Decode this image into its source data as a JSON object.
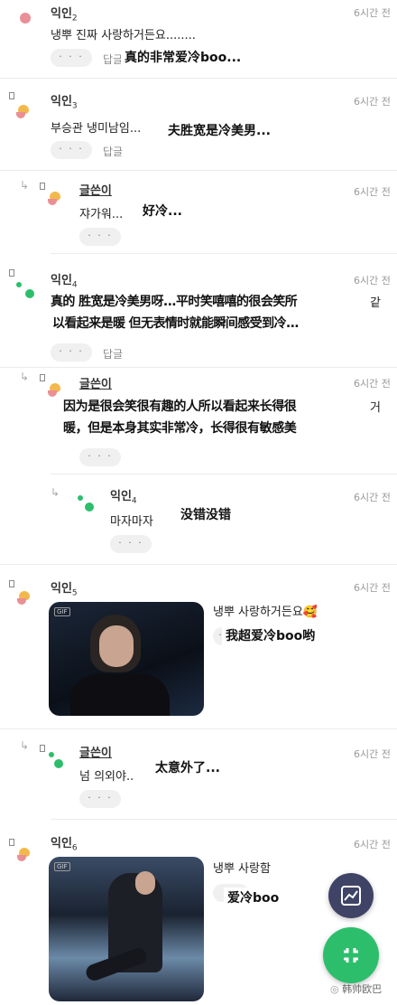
{
  "colors": {
    "accent_green": "#2dbe6c",
    "fab_navy": "#3f4366",
    "avatar_orange": "#f3b84c",
    "avatar_pink": "#e98f95"
  },
  "comments": [
    {
      "author": "익인",
      "num": "2",
      "time": "6시간 전",
      "text": "냉뿌 진짜 사랑하거든요........",
      "more": "· · ·",
      "reply": "답글",
      "caption": "真的非常爱冷boo..."
    },
    {
      "author": "익인",
      "num": "3",
      "time": "6시간 전",
      "text": "부승관 냉미남임...",
      "more": "· · ·",
      "reply": "답글",
      "caption": "夫胜宽是冷美男..."
    },
    {
      "author": "글쓴이",
      "time": "6시간 전",
      "text": "쟈가워...",
      "more": "· · ·",
      "caption": "好冷..."
    },
    {
      "author": "익인",
      "num": "4",
      "time": "6시간 전",
      "text": "",
      "more": "· · ·",
      "reply": "답글",
      "caption_line1": "真的 胜宽是冷美男呀...平时笑嘻嘻的很会笑所",
      "caption_line2": "以看起来是暖 但无表情时就能瞬间感受到冷...",
      "edge_text": "같"
    },
    {
      "author": "글쓴이",
      "time": "6시간 전",
      "more": "· · ·",
      "caption_line1": "因为是很会笑很有趣的人所以看起来长得很",
      "caption_line2": "暖，但是本身其实非常冷，长得很有敏感美",
      "edge_text": "거"
    },
    {
      "author": "익인",
      "num": "4",
      "time": "6시간 전",
      "text": "마자마자",
      "more": "· · ·",
      "caption": "没错没错"
    },
    {
      "author": "익인",
      "num": "5",
      "time": "6시간 전",
      "text": "냉뿌 사랑하거든요🥰",
      "more": "· · ·",
      "caption": "我超爱冷boo哟",
      "gif_badge": "GIF"
    },
    {
      "author": "글쓴이",
      "time": "6시간 전",
      "text": "넘 의외야..",
      "more": "· · ·",
      "caption": "太意外了..."
    },
    {
      "author": "익인",
      "num": "6",
      "time": "6시간 전",
      "text": "냉뿌 사랑함",
      "caption": "爱冷boo",
      "gif_badge": "GIF"
    }
  ],
  "watermark": "韩帅欧巴"
}
